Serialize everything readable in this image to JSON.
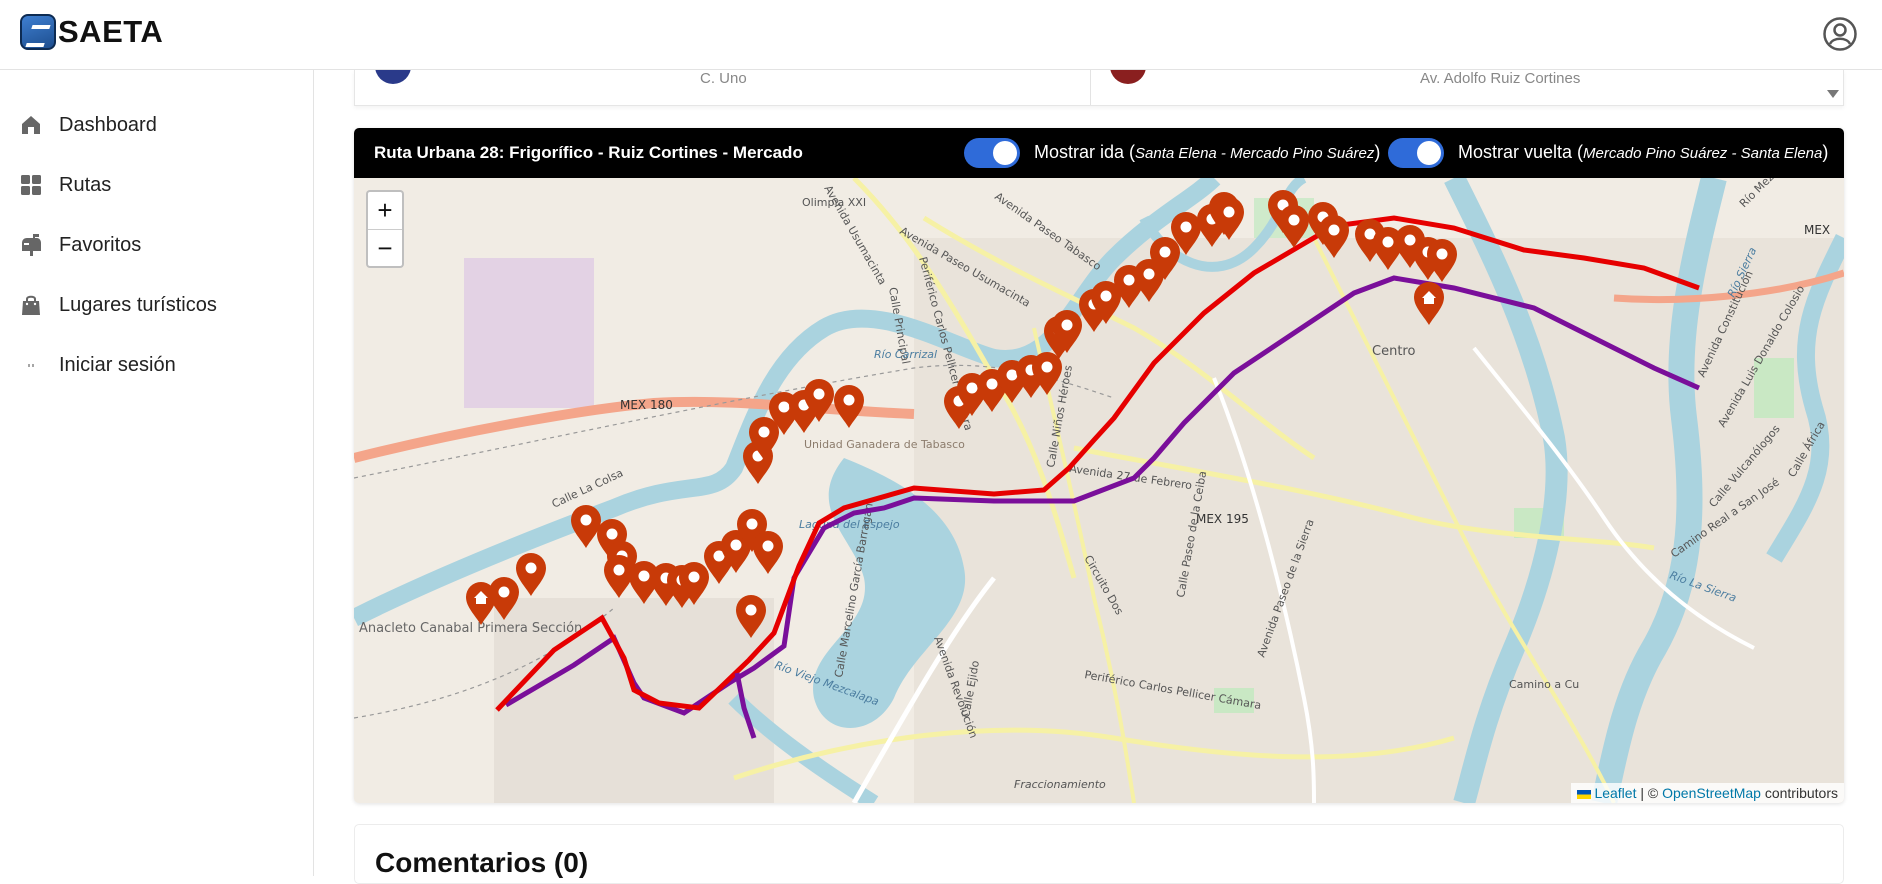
{
  "header": {
    "app_name": "SAETA",
    "logo_icon": "saeta-logo",
    "account_icon": "user-circle-icon"
  },
  "sidebar": {
    "items": [
      {
        "label": "Dashboard",
        "icon": "home-icon"
      },
      {
        "label": "Rutas",
        "icon": "grid-icon"
      },
      {
        "label": "Favoritos",
        "icon": "mailbox-icon"
      },
      {
        "label": "Lugares turísticos",
        "icon": "shopping-bag-icon"
      },
      {
        "label": "Iniciar sesión",
        "icon": "login-icon"
      }
    ]
  },
  "previous_card": {
    "left_text": "C. Uno",
    "right_text": "Av. Adolfo Ruiz Cortines",
    "left_color": "#2a3a8a",
    "right_color": "#8a1f1f"
  },
  "route": {
    "title": "Ruta Urbana 28: Frigorífico - Ruiz Cortines - Mercado",
    "toggle_ida": {
      "label": "Mostrar ida",
      "detail": "Santa Elena - Mercado Pino Suárez",
      "on": true
    },
    "toggle_vuelta": {
      "label": "Mostrar vuelta",
      "detail": "Mercado Pino Suárez - Santa Elena",
      "on": true
    },
    "colors": {
      "ida": "#e60000",
      "vuelta": "#7a0f9a",
      "marker": "#c83a08",
      "toggle": "#2f6bd9"
    }
  },
  "map": {
    "zoom_in": "+",
    "zoom_out": "−",
    "attribution_leaflet": "Leaflet",
    "attribution_sep": "| ©",
    "attribution_osm": "OpenStreetMap",
    "attribution_suffix": "contributors",
    "labels": [
      "Olimpia XXI",
      "Avenida Usumacinta",
      "Avenida Paseo Usumacinta",
      "Avenida Paseo Tabasco",
      "Calle Principal",
      "Periférico Carlos Pellicer Cámara",
      "Río Carrizal",
      "MEX 180",
      "Unidad Ganadera de Tabasco",
      "Laguna del Espejo",
      "Calle La Colsa",
      "Anacleto Canabal Primera Sección",
      "Avenida 27 de Febrero",
      "MEX 195",
      "Centro",
      "Río Viejo Mezcalapa",
      "Río Mezcalapa",
      "Avenida Revolución",
      "Calle Ejido",
      "Calle Niños Héroes",
      "Circuito Dos",
      "Calle Paseo de la Ceiba",
      "Avenida Paseo de la Sierra",
      "Periférico Carlos Pellicer Cámara",
      "Fraccionamiento",
      "Camino a Cu",
      "Río La Sierra",
      "Camino Real a San José",
      "Calle Vulcanólogos",
      "Calle África",
      "Avenida Constitución",
      "Avenida Luis Donaldo Colosio",
      "MEX",
      "Calle Marcelino García Barragán",
      "Río Sierra"
    ]
  },
  "comments": {
    "title": "Comentarios (0)"
  }
}
